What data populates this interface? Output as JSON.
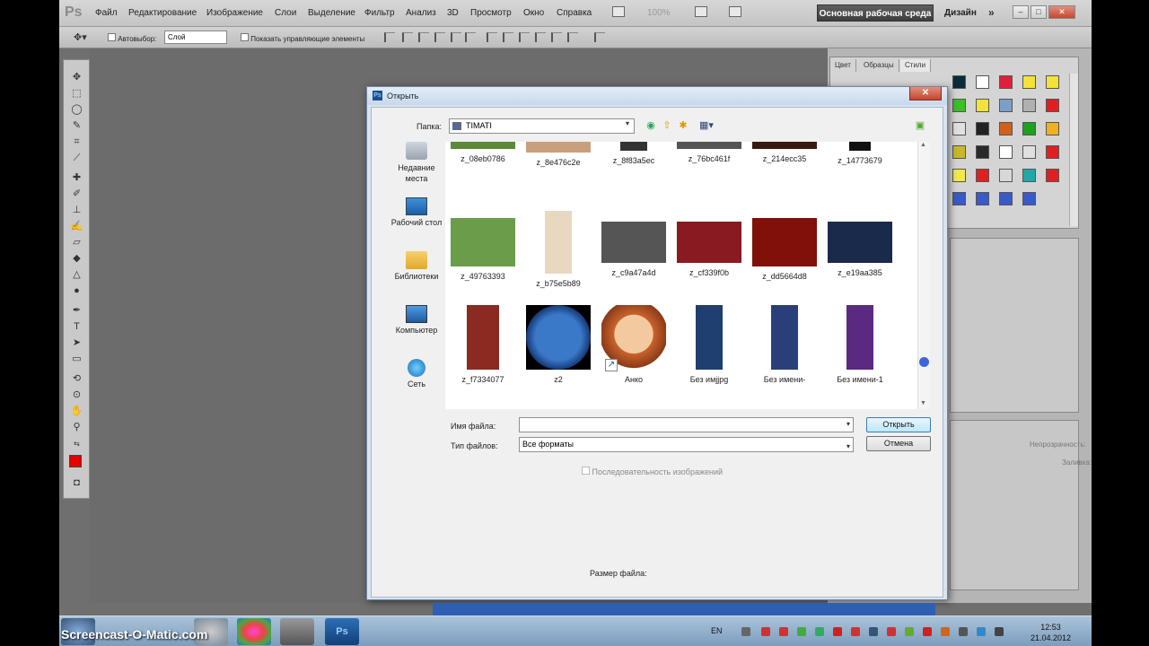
{
  "app": {
    "logo": "Ps",
    "menu": [
      "Файл",
      "Редактирование",
      "Изображение",
      "Слои",
      "Выделение",
      "Фильтр",
      "Анализ",
      "3D",
      "Просмотр",
      "Окно",
      "Справка"
    ],
    "zoom": "100%",
    "workspace": "Основная рабочая среда",
    "design": "Дизайн"
  },
  "options": {
    "autoselect_label": "Автовыбор:",
    "layer_value": "Слой",
    "show_controls_label": "Показать управляющие элементы"
  },
  "panels": {
    "tabs": [
      "Цвет",
      "Образцы",
      "Стили"
    ],
    "opacity_label": "Непрозрачность:",
    "fill_label": "Заливка:"
  },
  "dialog": {
    "title": "Открыть",
    "folder_label": "Папка:",
    "folder_value": "TIMATI",
    "places": [
      "Недавние места",
      "Рабочий стол",
      "Библиотеки",
      "Компьютер",
      "Сеть"
    ],
    "files": [
      [
        "z_08eb0786",
        "z_8e476c2e",
        "z_8f83a5ec",
        "z_76bc461f",
        "z_214ecc35",
        "z_14773679"
      ],
      [
        "z_49763393",
        "z_b75e5b89",
        "z_c9a47a4d",
        "z_cf339f0b",
        "z_dd5664d8",
        "z_e19aa385"
      ],
      [
        "z_f7334077",
        "z2",
        "Анко",
        "Без имjjpg",
        "Без имени-",
        "Без имени-1"
      ]
    ],
    "filename_label": "Имя файла:",
    "filename_value": "",
    "filetype_label": "Тип файлов:",
    "filetype_value": "Все форматы",
    "open_button": "Открыть",
    "cancel_button": "Отмена",
    "sequence_label": "Последовательность изображений",
    "filesize_label": "Размер файла:"
  },
  "taskbar": {
    "watermark": "Screencast-O-Matic.com",
    "lang": "EN",
    "time": "12:53",
    "date": "21.04.2012"
  }
}
